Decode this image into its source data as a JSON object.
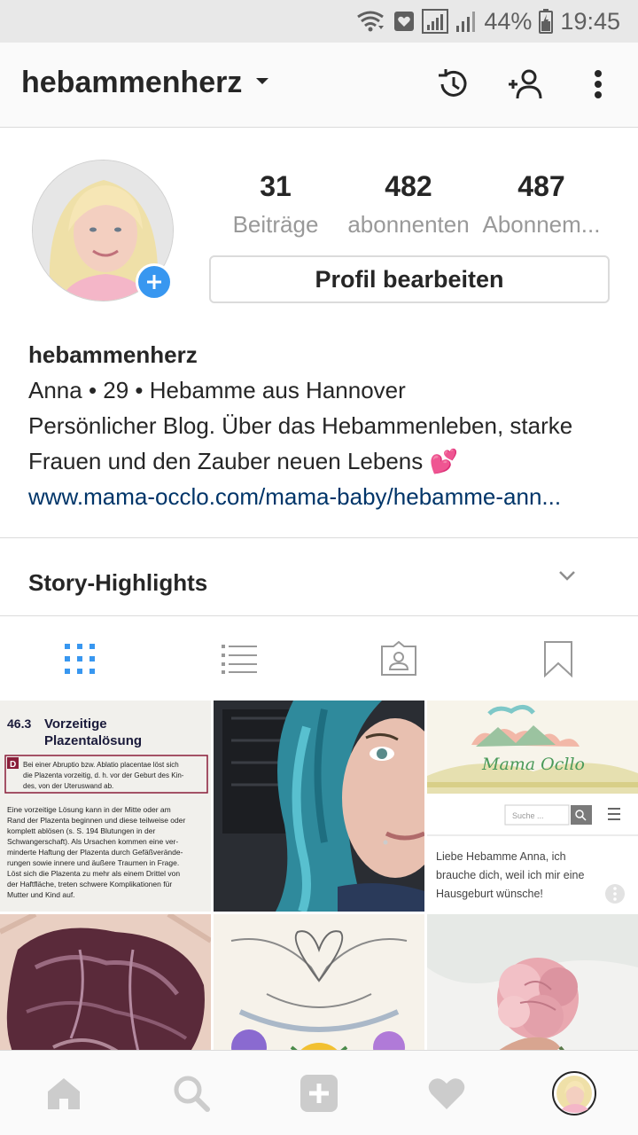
{
  "status_bar": {
    "battery": "44%",
    "time": "19:45"
  },
  "header": {
    "username": "hebammenherz"
  },
  "profile": {
    "stats": [
      {
        "count": "31",
        "label": "Beiträge"
      },
      {
        "count": "482",
        "label": "abonnenten"
      },
      {
        "count": "487",
        "label": "Abonnem..."
      }
    ],
    "edit_button": "Profil bearbeiten",
    "bio": {
      "name": "hebammenherz",
      "line1": "Anna • 29 • Hebamme aus Hannover",
      "line2": "Persönlicher Blog. Über das Hebammenleben, starke",
      "line3": "Frauen und den Zauber neuen Lebens 💕",
      "link": "www.mama-occlo.com/mama-baby/hebamme-ann..."
    }
  },
  "highlights": {
    "title": "Story-Highlights"
  },
  "posts": {
    "post1": {
      "heading_number": "46.3",
      "heading_line1": "Vorzeitige",
      "heading_line2": "Plazentalösung",
      "box_letter": "D",
      "box_text1": "Bei einer Abruptio bzw. Ablatio placentae löst sich",
      "box_text2": "die Plazenta vorzeitig, d. h. vor der Geburt des Kin-",
      "box_text3": "des, von der Uteruswand ab.",
      "body1": "Eine vorzeitige Lösung kann in der Mitte oder am",
      "body2": "Rand der Plazenta beginnen und diese teilweise oder",
      "body3": "komplett ablösen (s. S. 194 Blutungen in der",
      "body4": "Schwangerschaft). Als Ursachen kommen eine ver-",
      "body5": "minderte Haftung der Plazenta durch Gefäßverände-",
      "body6": "rungen sowie innere und äußere Traumen in Frage.",
      "body7": "Löst sich die Plazenta zu mehr als einem Drittel von",
      "body8": "der Haftfläche, treten schwere Komplikationen für",
      "body9": "Mutter und Kind auf."
    },
    "post3": {
      "logo": "Mama Ocllo",
      "search_placeholder": "Suche ...",
      "caption1": "Liebe Hebamme Anna, ich",
      "caption2": "brauche dich, weil ich mir eine",
      "caption3": "Hausgeburt wünsche!"
    }
  },
  "colors": {
    "accent": "#3897f0",
    "link": "#003569",
    "muted": "#999999",
    "text": "#262626"
  },
  "icons": {
    "header": [
      "chevron-down-icon",
      "archive-history-icon",
      "discover-people-icon",
      "more-options-icon"
    ],
    "tabs": [
      "grid-icon",
      "list-icon",
      "tagged-icon",
      "saved-icon"
    ],
    "nav": [
      "home-icon",
      "search-icon",
      "new-post-icon",
      "activity-heart-icon",
      "profile-avatar"
    ]
  }
}
